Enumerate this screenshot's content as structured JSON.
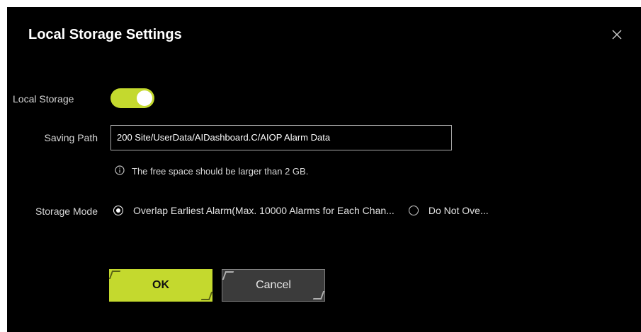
{
  "dialog": {
    "title": "Local Storage Settings",
    "close_icon": "close-icon"
  },
  "local_storage": {
    "label": "Local Storage",
    "enabled": true,
    "accent_color": "#c4d92e"
  },
  "saving_path": {
    "label": "Saving Path",
    "value": "200 Site/UserData/AIDashboard.C/AIOP Alarm Data"
  },
  "hint": {
    "icon": "info-icon",
    "text": "The free space should be larger than 2 GB."
  },
  "storage_mode": {
    "label": "Storage Mode",
    "options": [
      {
        "label": "Overlap Earliest Alarm(Max. 10000 Alarms for Each Chan...",
        "checked": true
      },
      {
        "label": "Do Not Ove...",
        "checked": false
      }
    ]
  },
  "buttons": {
    "ok_label": "OK",
    "cancel_label": "Cancel"
  }
}
